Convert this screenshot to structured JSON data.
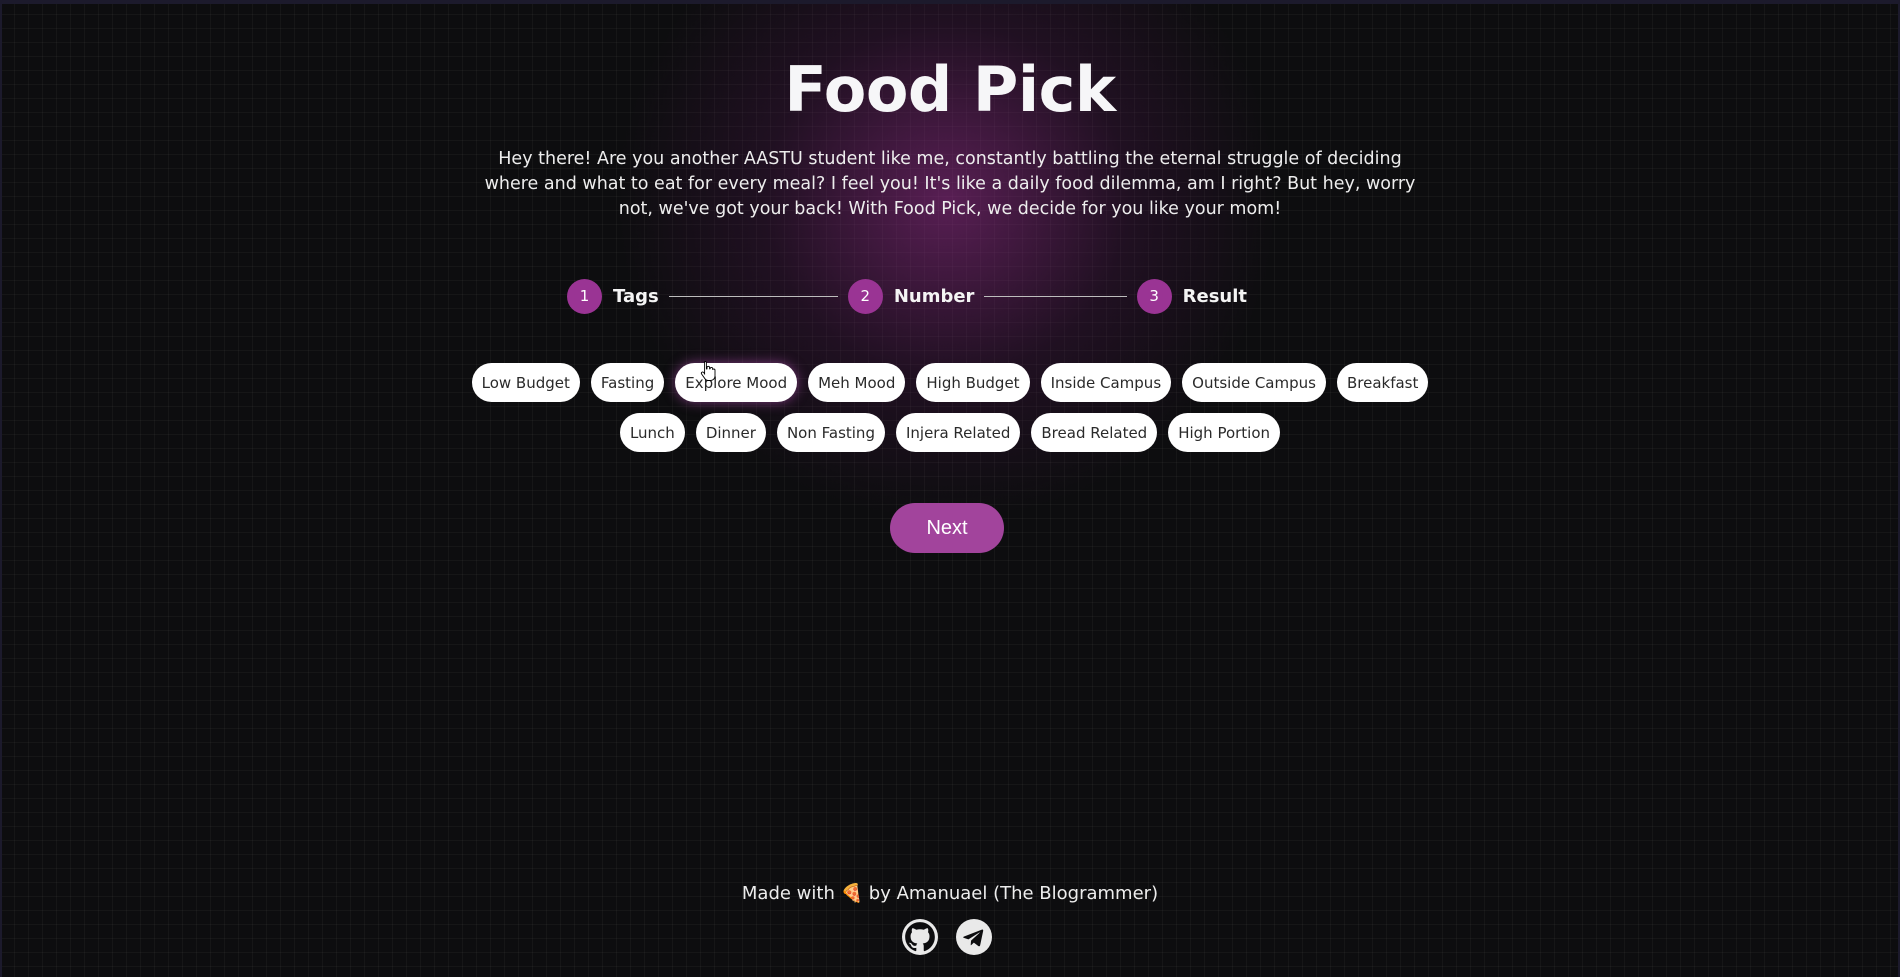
{
  "page": {
    "title": "Food Pick",
    "intro": "Hey there! Are you another AASTU student like me, constantly battling the eternal struggle of deciding where and what to eat for every meal? I feel you! It's like a daily food dilemma, am I right? But hey, worry not, we've got your back! With Food Pick, we decide for you like your mom!"
  },
  "stepper": {
    "steps": [
      {
        "number": "1",
        "label": "Tags"
      },
      {
        "number": "2",
        "label": "Number"
      },
      {
        "number": "3",
        "label": "Result"
      }
    ],
    "active_color": "#9a3494"
  },
  "tags": [
    "Low Budget",
    "Fasting",
    "Explore Mood",
    "Meh Mood",
    "High Budget",
    "Inside Campus",
    "Outside Campus",
    "Breakfast",
    "Lunch",
    "Dinner",
    "Non Fasting",
    "Injera Related",
    "Bread Related",
    "High Portion"
  ],
  "hovered_tag": "Explore Mood",
  "actions": {
    "next_label": "Next",
    "next_color": "#a2449c"
  },
  "footer": {
    "prefix": "Made with",
    "emoji": "🍕",
    "suffix": "by Amanuael (The Blogrammer)",
    "icons": [
      "github-icon",
      "telegram-icon"
    ]
  }
}
